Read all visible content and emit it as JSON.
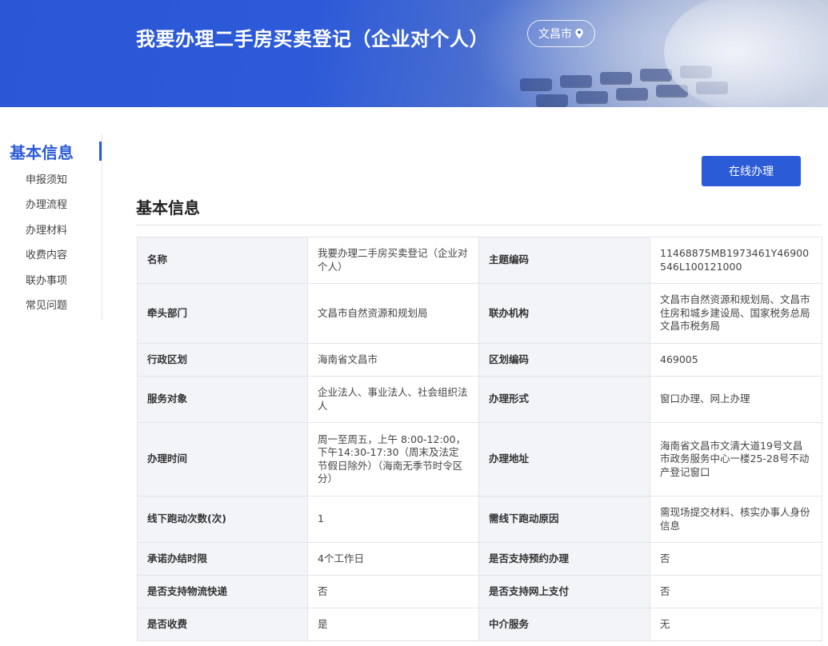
{
  "banner": {
    "title": "我要办理二手房买卖登记（企业对个人）",
    "city": "文昌市",
    "city_icon": "location-pin-icon"
  },
  "sidebar": {
    "title": "基本信息",
    "items": [
      {
        "label": "申报须知"
      },
      {
        "label": "办理流程"
      },
      {
        "label": "办理材料"
      },
      {
        "label": "收费内容"
      },
      {
        "label": "联办事项"
      },
      {
        "label": "常见问题"
      }
    ]
  },
  "actions": {
    "online_label": "在线办理"
  },
  "section": {
    "title": "基本信息"
  },
  "info": {
    "rows": [
      [
        {
          "label": "名称",
          "value": "我要办理二手房买卖登记（企业对个人）"
        },
        {
          "label": "主题编码",
          "value": "11468875MB1973461Y46900546L100121000"
        }
      ],
      [
        {
          "label": "牵头部门",
          "value": "文昌市自然资源和规划局"
        },
        {
          "label": "联办机构",
          "value": "文昌市自然资源和规划局、文昌市住房和城乡建设局、国家税务总局文昌市税务局"
        }
      ],
      [
        {
          "label": "行政区划",
          "value": "海南省文昌市"
        },
        {
          "label": "区划编码",
          "value": "469005"
        }
      ],
      [
        {
          "label": "服务对象",
          "value": "企业法人、事业法人、社会组织法人"
        },
        {
          "label": "办理形式",
          "value": "窗口办理、网上办理"
        }
      ],
      [
        {
          "label": "办理时间",
          "value": "周一至周五，上午 8:00-12:00，下午14:30-17:30（周末及法定节假日除外）（海南无季节时令区分）"
        },
        {
          "label": "办理地址",
          "value": "海南省文昌市文清大道19号文昌市政务服务中心一楼25-28号不动产登记窗口"
        }
      ],
      [
        {
          "label": "线下跑动次数(次)",
          "value": "1"
        },
        {
          "label": "需线下跑动原因",
          "value": "需现场提交材料、核实办事人身份信息"
        }
      ],
      [
        {
          "label": "承诺办结时限",
          "value": "4个工作日"
        },
        {
          "label": "是否支持预约办理",
          "value": "否"
        }
      ],
      [
        {
          "label": "是否支持物流快递",
          "value": "否"
        },
        {
          "label": "是否支持网上支付",
          "value": "否"
        }
      ],
      [
        {
          "label": "是否收费",
          "value": "是"
        },
        {
          "label": "中介服务",
          "value": "无"
        }
      ]
    ]
  },
  "colors": {
    "accent": "#2b5bd7",
    "label_bg": "#f2f4f8",
    "border": "#e1e4ea"
  }
}
